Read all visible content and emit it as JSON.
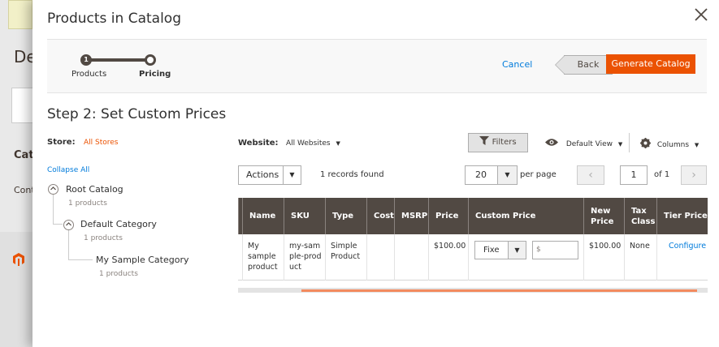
{
  "background": {
    "title_fragment": "De",
    "section_fragment": "Cata",
    "content_fragment": "Cont"
  },
  "modal": {
    "title": "Products in Catalog",
    "close_icon": "close-icon"
  },
  "wizard": {
    "steps": [
      {
        "number": "1",
        "label": "Products",
        "completed": true
      },
      {
        "number": "",
        "label": "Pricing",
        "active": true
      }
    ],
    "cancel_label": "Cancel",
    "back_label": "Back",
    "generate_label": "Generate Catalog"
  },
  "page": {
    "heading": "Step 2: Set Custom Prices"
  },
  "store": {
    "label": "Store:",
    "value": "All Stores"
  },
  "tree": {
    "collapse_label": "Collapse All",
    "nodes": [
      {
        "label": "Root Catalog",
        "count": "1 products"
      },
      {
        "label": "Default Category",
        "count": "1 products"
      },
      {
        "label": "My Sample Category",
        "count": "1 products"
      }
    ]
  },
  "toolbar": {
    "website_label": "Website:",
    "website_value": "All Websites",
    "filters_label": "Filters",
    "view_label": "Default View",
    "columns_label": "Columns",
    "actions_label": "Actions",
    "records_found": "1 records found",
    "per_page_value": "20",
    "per_page_label": "per page",
    "current_page": "1",
    "of_pages": "of 1"
  },
  "table": {
    "columns": [
      "Name",
      "SKU",
      "Type",
      "Cost",
      "MSRP",
      "Price",
      "Custom Price",
      "New Price",
      "Tax Class",
      "Tier Price"
    ],
    "row": {
      "name": "My sample product",
      "sku": "my-sample-product",
      "type": "Simple Product",
      "cost": "",
      "msrp": "",
      "price": "$100.00",
      "custom_price_mode": "Fixe",
      "custom_price_placeholder": "$",
      "new_price": "$100.00",
      "tax_class": "None",
      "tier_price": "Configure"
    }
  },
  "colors": {
    "accent": "#eb5202",
    "link": "#007bdb",
    "header_bg": "#514943"
  }
}
